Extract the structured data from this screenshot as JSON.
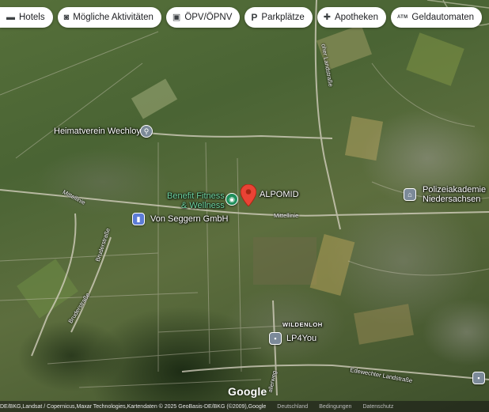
{
  "filters": [
    {
      "label": "Hotels",
      "icon": "bed-icon",
      "glyph": "▬"
    },
    {
      "label": "Mögliche Aktivitäten",
      "icon": "camera-icon",
      "glyph": "◙"
    },
    {
      "label": "ÖPV/ÖPNV",
      "icon": "bus-icon",
      "glyph": "▣"
    },
    {
      "label": "Parkplätze",
      "icon": "parking-icon",
      "glyph": "P"
    },
    {
      "label": "Apotheken",
      "icon": "pharmacy-icon",
      "glyph": "✚"
    },
    {
      "label": "Geldautomaten",
      "icon": "atm-icon",
      "glyph": "ATM"
    }
  ],
  "places": {
    "heimatverein": "Heimatverein Wechloy",
    "benefit": "Benefit Fitness\n& Wellness",
    "alpomid": "ALPOMID",
    "seggern": "Von Seggern GmbH",
    "polizei": "Polizeiakademie\nNiedersachsen",
    "lp4you": "LP4You",
    "wildenloh": "WILDENLOH"
  },
  "streets": {
    "mittellinie_w": "Mittellinie",
    "mittellinie_e": "Mittellinie",
    "bruderstrasse_1": "Bruderstraße",
    "bruderstrasse_2": "Bruderstraße",
    "landstrasse_n": "oher Landstraße",
    "edewechter": "Edewechter Landstraße",
    "allerweg": "allerweg"
  },
  "branding": {
    "google": "Google"
  },
  "footer": {
    "attribution": "DE/BKG,Landsat / Copernicus,Maxar Technologies,Kartendaten © 2025 GeoBasis-DE/BKG (©2009),Google",
    "country": "Deutschland",
    "terms": "Bedingungen",
    "privacy": "Datenschutz"
  },
  "colors": {
    "selected_pin": "#ea4335",
    "fitness_pin": "#1e8e5a",
    "poi_blue": "#5c7cd6",
    "poi_gray": "#7c8a99"
  }
}
